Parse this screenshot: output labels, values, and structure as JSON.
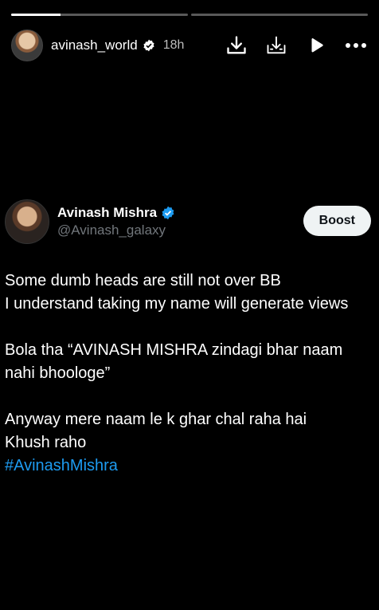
{
  "story": {
    "progress": [
      0.28,
      0.0
    ],
    "username": "avinash_world",
    "time": "18h"
  },
  "tweet": {
    "display_name": "Avinash Mishra",
    "handle": "@Avinash_galaxy",
    "boost_label": "Boost",
    "lines": [
      [
        "Some dumb heads are still not over BB",
        "I understand taking my name will generate views"
      ],
      [
        "Bola tha “AVINASH MISHRA zindagi bhar naam",
        "nahi bhoologe”"
      ],
      [
        "Anyway mere naam le k ghar chal raha hai",
        "Khush raho"
      ]
    ],
    "hashtag": "#AvinashMishra"
  },
  "colors": {
    "link": "#1d9bf0",
    "verified": "#1d9bf0",
    "background": "#000000"
  },
  "icons": [
    "download-icon",
    "save-icon",
    "play-icon",
    "more-icon",
    "verified-icon"
  ]
}
